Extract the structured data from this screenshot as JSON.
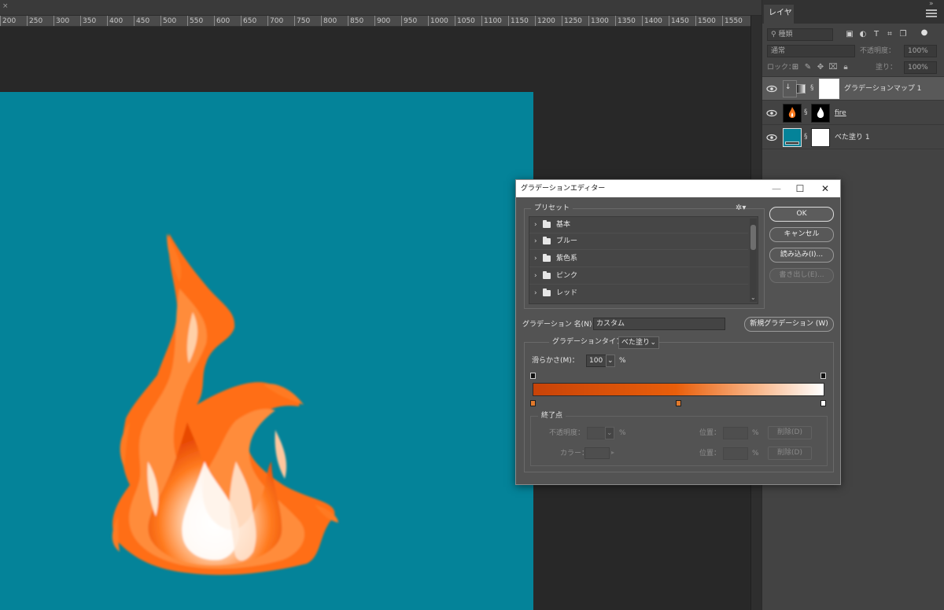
{
  "ruler": {
    "ticks": [
      "200",
      "250",
      "300",
      "350",
      "400",
      "450",
      "500",
      "550",
      "600",
      "650",
      "700",
      "750",
      "800",
      "850",
      "900",
      "950",
      "1000",
      "1050",
      "1100",
      "1150",
      "1200",
      "1250",
      "1300",
      "1350",
      "1400",
      "1450",
      "1500",
      "1550"
    ]
  },
  "canvas": {
    "bg_color": "#048399"
  },
  "layers_panel": {
    "tab_label": "レイヤー",
    "filter_placeholder": "種類",
    "blend_mode": "通常",
    "opacity_label": "不透明度：",
    "opacity_value": "100%",
    "lock_label": "ロック：",
    "fill_label": "塗り：",
    "fill_value": "100%",
    "layers": [
      {
        "name": "グラデーションマップ 1"
      },
      {
        "name": "fire"
      },
      {
        "name": "べた塗り 1"
      }
    ]
  },
  "gradient_editor": {
    "title": "グラデーションエディター",
    "presets_label": "プリセット",
    "presets": [
      "基本",
      "ブルー",
      "紫色系",
      "ピンク",
      "レッド"
    ],
    "buttons": {
      "ok": "OK",
      "cancel": "キャンセル",
      "load": "読み込み(I)...",
      "save": "書き出し(E)...",
      "new_gradient": "新規グラデーション (W)"
    },
    "name_label": "グラデーション 名(N)：",
    "name_value": "カスタム",
    "type_label": "グラデーションタイプ：",
    "type_value": "べた塗り",
    "smoothness_label": "滑らかさ(M)：",
    "smoothness_value": "100",
    "percent": "%",
    "stops_label": "終了点",
    "stop_opacity_label": "不透明度：",
    "stop_color_label": "カラー：",
    "location_label": "位置：",
    "delete_label": "削除(D)",
    "gradient_colors": [
      "#c84308",
      "#e85e0a",
      "#f9b98e",
      "#ffffff"
    ],
    "color_stop_colors": [
      "#e27a2c",
      "#e27a2c",
      "#ffffff"
    ]
  }
}
